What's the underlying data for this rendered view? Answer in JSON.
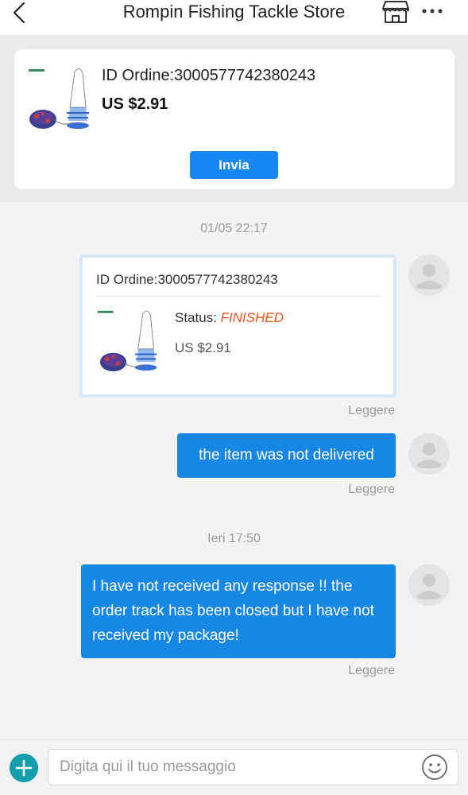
{
  "header": {
    "title": "Rompin Fishing Tackle Store",
    "back_icon": "chevron-left-icon",
    "store_icon": "store-icon",
    "more_icon": "more-dots-icon"
  },
  "order_card": {
    "order_id": "ID Ordine:3000577742380243",
    "price": "US $2.91",
    "send_label": "Invia",
    "accent_color": "#1787f2"
  },
  "chat": {
    "timestamp_1": "01/05 22:17",
    "order_message": {
      "order_id": "ID Ordine:3000577742380243",
      "status_label": "Status:",
      "status_value": "FINISHED",
      "price": "US $2.91",
      "read_label": "Leggere"
    },
    "message_1": {
      "text": "the item was not delivered",
      "read_label": "Leggere"
    },
    "timestamp_2": "Ieri 17:50",
    "message_2": {
      "text": "I have not received any response !!  the order track has been closed but I have not received my package!",
      "read_label": "Leggere"
    },
    "bubble_color": "#1787e6",
    "status_color": "#f2561d"
  },
  "input_bar": {
    "placeholder": "Digita qui il tuo messaggio",
    "add_icon": "plus-circle-icon",
    "emoji_icon": "smiley-icon"
  }
}
